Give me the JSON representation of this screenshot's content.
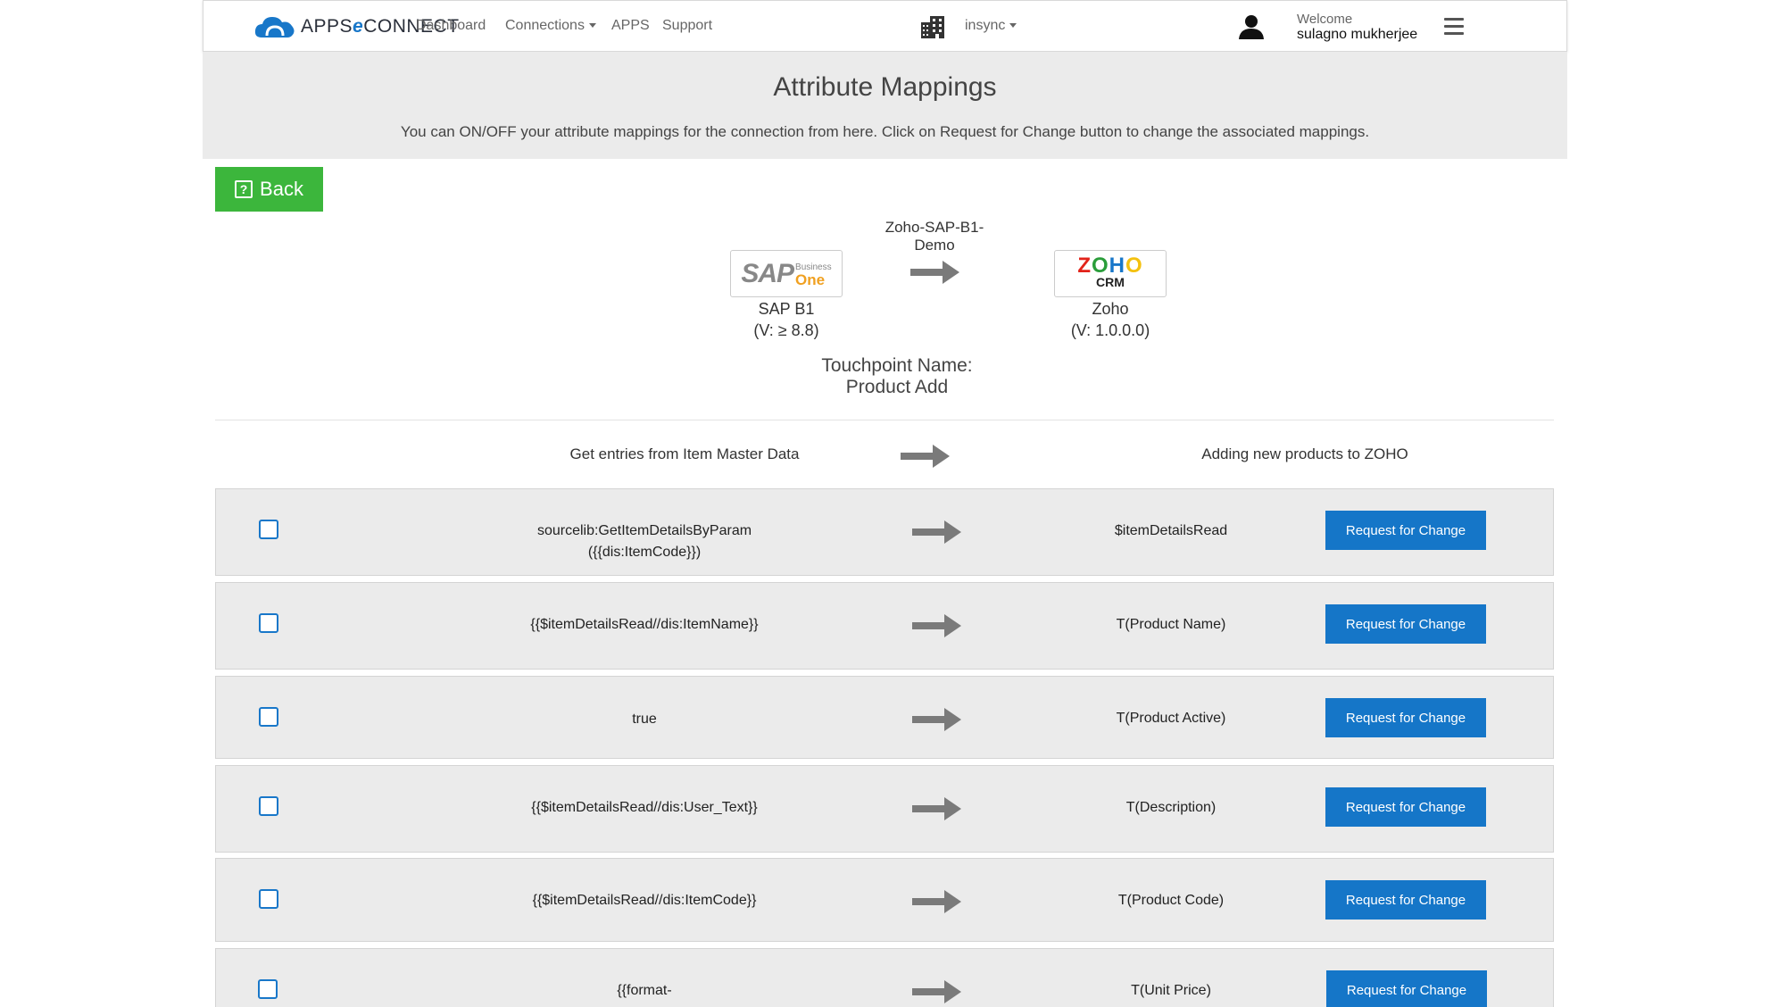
{
  "brand": {
    "name_part1": "APPS",
    "name_amp": "е",
    "name_part2": "CONNECT"
  },
  "nav": {
    "dashboard": "Dashboard",
    "connections": "Connections",
    "apps": "APPS",
    "support": "Support",
    "org": "insync"
  },
  "user": {
    "welcome": "Welcome",
    "name": "sulagno mukherjee"
  },
  "header": {
    "title": "Attribute Mappings",
    "subtitle": "You can ON/OFF your attribute mappings for the connection from here. Click on Request for Change button to change the associated mappings."
  },
  "back_label": "Back",
  "connection": {
    "name": "Zoho-SAP-B1-Demo",
    "source": {
      "name": "SAP B1",
      "version": "(V: ≥ 8.8)",
      "logo_text": "SAP",
      "logo_sub1": "Business",
      "logo_sub2": "One"
    },
    "target": {
      "name": "Zoho",
      "version": "(V: 1.0.0.0)",
      "logo_text": "ZOHO",
      "logo_sub": "CRM"
    }
  },
  "touchpoint": {
    "label": "Touchpoint Name:",
    "value": "Product Add"
  },
  "flow": {
    "left": "Get entries from Item Master Data",
    "right": "Adding new products to ZOHO"
  },
  "request_label": "Request for Change",
  "mappings": [
    {
      "source": "sourcelib:GetItemDetailsByParam({{dis:ItemCode}})",
      "target": "$itemDetailsRead"
    },
    {
      "source": "{{$itemDetailsRead//dis:ItemName}}",
      "target": "T(Product Name)"
    },
    {
      "source": "true",
      "target": "T(Product Active)"
    },
    {
      "source": "{{$itemDetailsRead//dis:User_Text}}",
      "target": "T(Description)"
    },
    {
      "source": "{{$itemDetailsRead//dis:ItemCode}}",
      "target": "T(Product Code)"
    },
    {
      "source": "{{format-",
      "target": "T(Unit Price)"
    }
  ],
  "colors": {
    "accent": "#1576c8",
    "back_button": "#3cb63c",
    "band": "#ebebeb"
  }
}
